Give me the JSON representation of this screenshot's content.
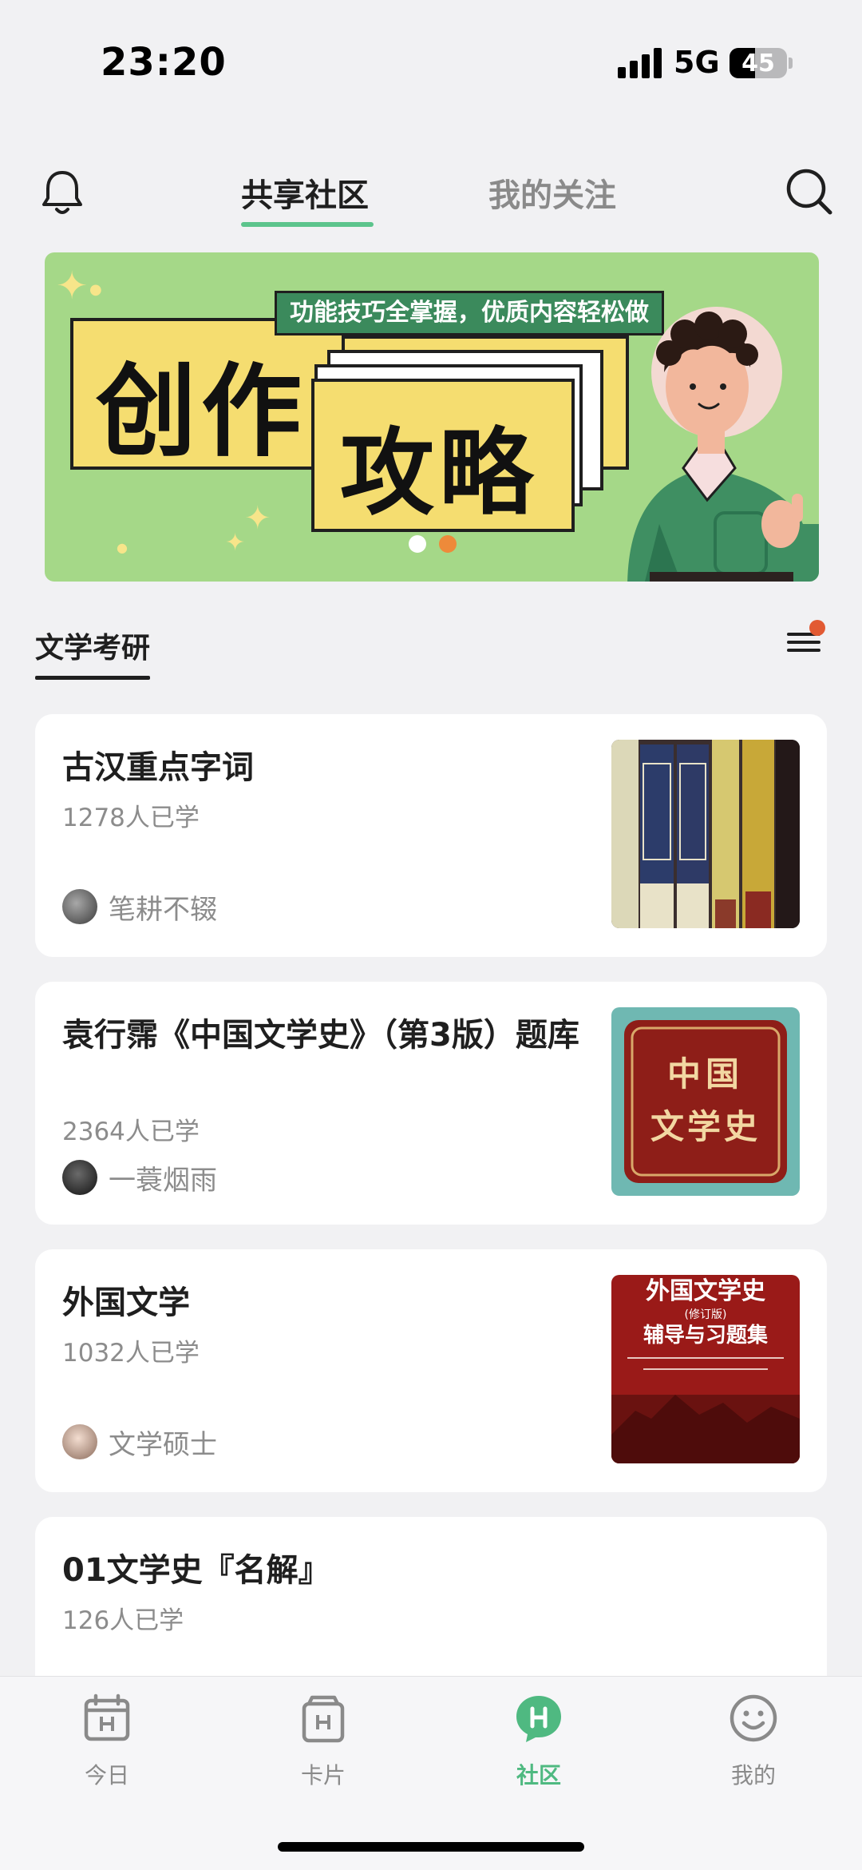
{
  "status_bar": {
    "time": "23:20",
    "network": "5G",
    "battery": "45",
    "battery_level": 0.45
  },
  "header": {
    "tabs": [
      {
        "label": "共享社区",
        "active": true
      },
      {
        "label": "我的关注",
        "active": false
      }
    ],
    "icons": {
      "left": "bell-icon",
      "right": "search-icon"
    },
    "accent_color": "#5cc48c"
  },
  "banner": {
    "tagline": "功能技巧全掌握，优质内容轻松做",
    "title_line1": "创作",
    "title_line2": "攻略",
    "slide_count": 2,
    "active_slide": 2
  },
  "section": {
    "title": "文学考研",
    "menu_icon": "menu-icon",
    "has_notification_dot": true
  },
  "cards": [
    {
      "title": "古汉重点字词",
      "count": "1278人已学",
      "author": "笔耕不辍",
      "cover_icon": "book-spines-cover"
    },
    {
      "title": "袁行霈《中国文学史》（第3版）题库",
      "count": "2364人已学",
      "author": "一蓑烟雨",
      "cover_icon": "book-cover-chinese-literature-history",
      "cover_text": [
        "中国",
        "文学史"
      ]
    },
    {
      "title": "外国文学",
      "count": "1032人已学",
      "author": "文学硕士",
      "cover_icon": "book-cover-foreign-literature",
      "cover_text": [
        "外国文学史",
        "(修订版)",
        "辅导与习题集"
      ]
    },
    {
      "title": "01文学史『名解』",
      "count": "126人已学"
    }
  ],
  "bottom_nav": [
    {
      "label": "今日",
      "icon": "calendar-icon",
      "active": false
    },
    {
      "label": "卡片",
      "icon": "cards-icon",
      "active": false
    },
    {
      "label": "社区",
      "icon": "community-icon",
      "active": true
    },
    {
      "label": "我的",
      "icon": "smiley-icon",
      "active": false
    }
  ]
}
